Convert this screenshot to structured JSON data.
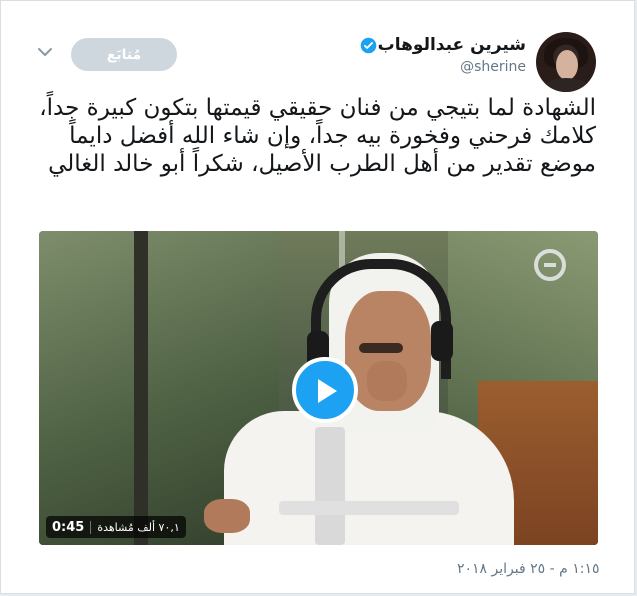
{
  "user": {
    "display_name": "شيرين عبدالوهاب",
    "handle": "@sherine",
    "verified": true
  },
  "actions": {
    "follow_label": "مُتابَع",
    "menu_icon": "chevron-down-icon"
  },
  "tweet": {
    "text": "الشهادة لما بتيجي من فنان حقيقي قيمتها بتكون كبيرة جداً، كلامك فرحني وفخورة بيه جداً، وإن شاء الله أفضل دايماً موضع تقدير من أهل الطرب الأصيل، شكراً أبو خالد الغالي"
  },
  "video": {
    "duration": "0:45",
    "views": "٧٠,١ ألف مُشاهدة",
    "play_icon": "play-icon"
  },
  "timestamp": "١:١٥ م - ٢٥ فبراير ٢٠١٨",
  "colors": {
    "accent": "#1da1f2",
    "follow_bg": "#cfd7de",
    "text": "#14171a",
    "muted": "#657786"
  }
}
